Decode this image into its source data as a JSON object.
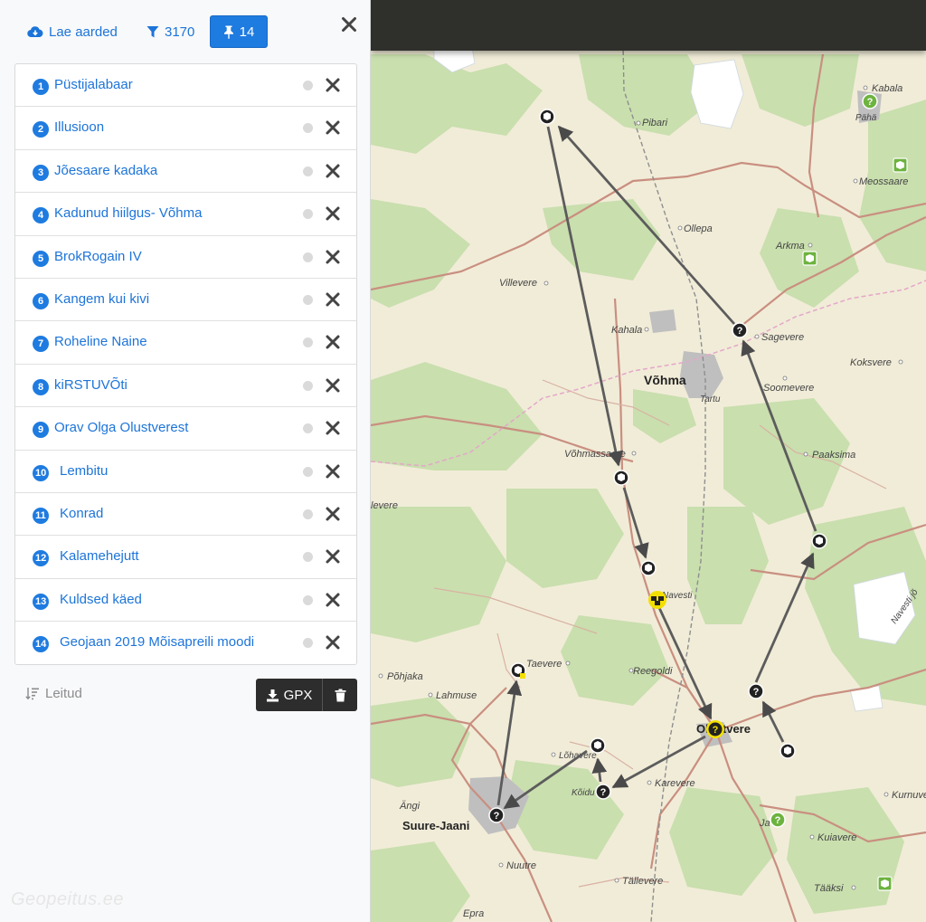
{
  "toolbar": {
    "download_label": "Lae aarded",
    "filter_count": "3170",
    "pinned_count": "14"
  },
  "caches": [
    {
      "num": "1",
      "name": "Püstijalabaar"
    },
    {
      "num": "2",
      "name": "Illusioon"
    },
    {
      "num": "3",
      "name": "Jõesaare kadaka"
    },
    {
      "num": "4",
      "name": "Kadunud hiilgus- Võhma"
    },
    {
      "num": "5",
      "name": "BrokRogain IV"
    },
    {
      "num": "6",
      "name": "Kangem kui kivi"
    },
    {
      "num": "7",
      "name": "Roheline Naine"
    },
    {
      "num": "8",
      "name": "kiRSTUVÕti"
    },
    {
      "num": "9",
      "name": "Orav Olga Olustverest"
    },
    {
      "num": "10",
      "name": "Lembitu"
    },
    {
      "num": "11",
      "name": "Konrad"
    },
    {
      "num": "12",
      "name": "Kalamehejutt"
    },
    {
      "num": "13",
      "name": "Kuldsed käed"
    },
    {
      "num": "14",
      "name": "Geojaan 2019 Mõisapreili moodi"
    }
  ],
  "footer": {
    "sort_label": "Leitud",
    "gpx_label": "GPX"
  },
  "watermark": "Geopeitus.ee",
  "colors": {
    "accent": "#1e7be0",
    "map_base": "#f1ecd8",
    "forest": "#c9dfae",
    "road": "#c98f80"
  },
  "map": {
    "places": [
      {
        "id": "kabala",
        "text": "Kabala"
      },
      {
        "id": "paha",
        "text": "Pähä"
      },
      {
        "id": "pibari",
        "text": "Pibari"
      },
      {
        "id": "meossaare",
        "text": "Meossaare"
      },
      {
        "id": "ollepa",
        "text": "Ollepa"
      },
      {
        "id": "arkma",
        "text": "Arkma"
      },
      {
        "id": "villevere",
        "text": "Villevere"
      },
      {
        "id": "kahala",
        "text": "Kahala"
      },
      {
        "id": "sagevere",
        "text": "Sagevere"
      },
      {
        "id": "vohma",
        "text": "Võhma"
      },
      {
        "id": "tartu",
        "text": "Tartu"
      },
      {
        "id": "koksvere",
        "text": "Koksvere"
      },
      {
        "id": "soomevere",
        "text": "Soomevere"
      },
      {
        "id": "vohmassaare",
        "text": "Võhmassaare"
      },
      {
        "id": "paaksima",
        "text": "Paaksima"
      },
      {
        "id": "levere",
        "text": "levere"
      },
      {
        "id": "navesti",
        "text": "Navesti"
      },
      {
        "id": "navesti_jogi",
        "text": "Navesti jõ"
      },
      {
        "id": "taevere",
        "text": "Taevere"
      },
      {
        "id": "pohjaka",
        "text": "Põhjaka"
      },
      {
        "id": "reegoldi",
        "text": "Reegoldi"
      },
      {
        "id": "lahmuse",
        "text": "Lahmuse"
      },
      {
        "id": "olustvere",
        "text": "Olustvere"
      },
      {
        "id": "lohavere",
        "text": "Lõhavere"
      },
      {
        "id": "karevere",
        "text": "Karevere"
      },
      {
        "id": "koidu",
        "text": "Kõidu"
      },
      {
        "id": "kurnuvere",
        "text": "Kurnuvere"
      },
      {
        "id": "angi",
        "text": "Ängi"
      },
      {
        "id": "suure_jaani",
        "text": "Suure-Jaani"
      },
      {
        "id": "jaska",
        "text": "Ja"
      },
      {
        "id": "kuiavere",
        "text": "Kuiavere"
      },
      {
        "id": "nuutre",
        "text": "Nuutre"
      },
      {
        "id": "tallevere",
        "text": "Tällevere"
      },
      {
        "id": "taaksi",
        "text": "Tääksi"
      },
      {
        "id": "epra",
        "text": "Epra"
      }
    ]
  }
}
